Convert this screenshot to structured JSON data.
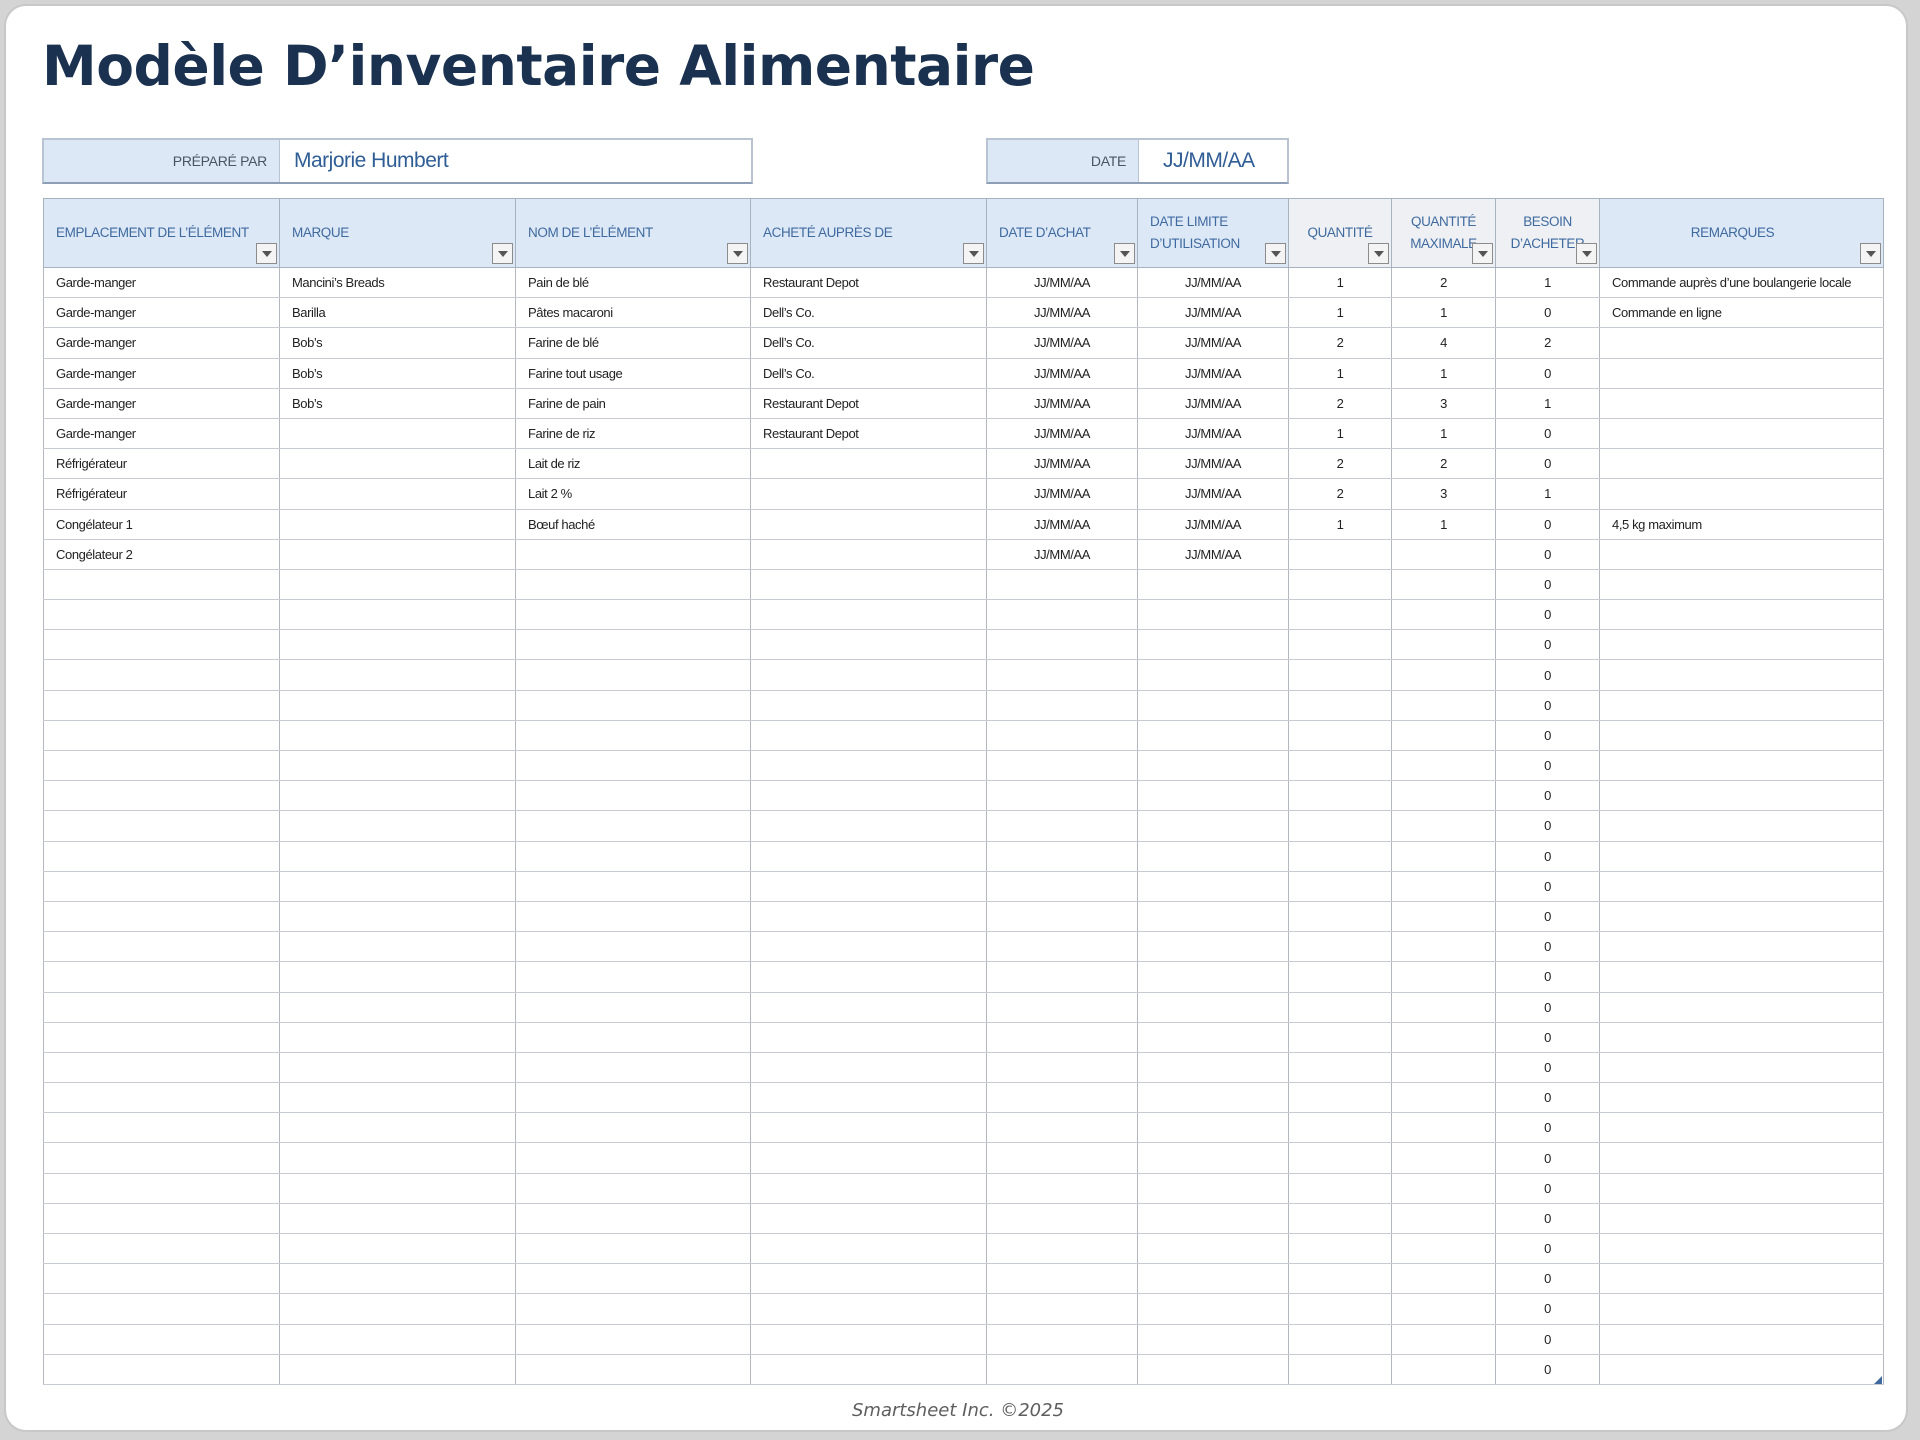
{
  "title": "Modèle D’inventaire Alimentaire",
  "prepared_by": {
    "label": "PRÉPARÉ PAR",
    "value": "Marjorie Humbert"
  },
  "date": {
    "label": "DATE",
    "value": "JJ/MM/AA"
  },
  "columns": [
    "EMPLACEMENT DE L’ÉLÉMENT",
    "MARQUE",
    "NOM DE L’ÉLÉMENT",
    "ACHETÉ AUPRÈS DE",
    "DATE D’ACHAT",
    "DATE LIMITE D’UTILISATION",
    "QUANTITÉ",
    "QUANTITÉ MAXIMALE",
    "BESOIN D’ACHETER",
    "REMARQUES"
  ],
  "rows": [
    [
      "Garde-manger",
      "Mancini’s Breads",
      "Pain de blé",
      "Restaurant Depot",
      "JJ/MM/AA",
      "JJ/MM/AA",
      "1",
      "2",
      "1",
      "Commande auprès d’une boulangerie locale"
    ],
    [
      "Garde-manger",
      "Barilla",
      "Pâtes macaroni",
      "Dell’s Co.",
      "JJ/MM/AA",
      "JJ/MM/AA",
      "1",
      "1",
      "0",
      "Commande en ligne"
    ],
    [
      "Garde-manger",
      "Bob’s",
      "Farine de blé",
      "Dell’s Co.",
      "JJ/MM/AA",
      "JJ/MM/AA",
      "2",
      "4",
      "2",
      ""
    ],
    [
      "Garde-manger",
      "Bob’s",
      "Farine tout usage",
      "Dell’s Co.",
      "JJ/MM/AA",
      "JJ/MM/AA",
      "1",
      "1",
      "0",
      ""
    ],
    [
      "Garde-manger",
      "Bob’s",
      "Farine de pain",
      "Restaurant Depot",
      "JJ/MM/AA",
      "JJ/MM/AA",
      "2",
      "3",
      "1",
      ""
    ],
    [
      "Garde-manger",
      "",
      "Farine de riz",
      "Restaurant Depot",
      "JJ/MM/AA",
      "JJ/MM/AA",
      "1",
      "1",
      "0",
      ""
    ],
    [
      "Réfrigérateur",
      "",
      "Lait de riz",
      "",
      "JJ/MM/AA",
      "JJ/MM/AA",
      "2",
      "2",
      "0",
      ""
    ],
    [
      "Réfrigérateur",
      "",
      "Lait 2 %",
      "",
      "JJ/MM/AA",
      "JJ/MM/AA",
      "2",
      "3",
      "1",
      ""
    ],
    [
      "Congélateur 1",
      "",
      "Bœuf haché",
      "",
      "JJ/MM/AA",
      "JJ/MM/AA",
      "1",
      "1",
      "0",
      "4,5 kg maximum"
    ],
    [
      "Congélateur 2",
      "",
      "",
      "",
      "JJ/MM/AA",
      "JJ/MM/AA",
      "",
      "",
      "0",
      ""
    ],
    [
      "",
      "",
      "",
      "",
      "",
      "",
      "",
      "",
      "0",
      ""
    ],
    [
      "",
      "",
      "",
      "",
      "",
      "",
      "",
      "",
      "0",
      ""
    ],
    [
      "",
      "",
      "",
      "",
      "",
      "",
      "",
      "",
      "0",
      ""
    ],
    [
      "",
      "",
      "",
      "",
      "",
      "",
      "",
      "",
      "0",
      ""
    ],
    [
      "",
      "",
      "",
      "",
      "",
      "",
      "",
      "",
      "0",
      ""
    ],
    [
      "",
      "",
      "",
      "",
      "",
      "",
      "",
      "",
      "0",
      ""
    ],
    [
      "",
      "",
      "",
      "",
      "",
      "",
      "",
      "",
      "0",
      ""
    ],
    [
      "",
      "",
      "",
      "",
      "",
      "",
      "",
      "",
      "0",
      ""
    ],
    [
      "",
      "",
      "",
      "",
      "",
      "",
      "",
      "",
      "0",
      ""
    ],
    [
      "",
      "",
      "",
      "",
      "",
      "",
      "",
      "",
      "0",
      ""
    ],
    [
      "",
      "",
      "",
      "",
      "",
      "",
      "",
      "",
      "0",
      ""
    ],
    [
      "",
      "",
      "",
      "",
      "",
      "",
      "",
      "",
      "0",
      ""
    ],
    [
      "",
      "",
      "",
      "",
      "",
      "",
      "",
      "",
      "0",
      ""
    ],
    [
      "",
      "",
      "",
      "",
      "",
      "",
      "",
      "",
      "0",
      ""
    ],
    [
      "",
      "",
      "",
      "",
      "",
      "",
      "",
      "",
      "0",
      ""
    ],
    [
      "",
      "",
      "",
      "",
      "",
      "",
      "",
      "",
      "0",
      ""
    ],
    [
      "",
      "",
      "",
      "",
      "",
      "",
      "",
      "",
      "0",
      ""
    ],
    [
      "",
      "",
      "",
      "",
      "",
      "",
      "",
      "",
      "0",
      ""
    ],
    [
      "",
      "",
      "",
      "",
      "",
      "",
      "",
      "",
      "0",
      ""
    ],
    [
      "",
      "",
      "",
      "",
      "",
      "",
      "",
      "",
      "0",
      ""
    ],
    [
      "",
      "",
      "",
      "",
      "",
      "",
      "",
      "",
      "0",
      ""
    ],
    [
      "",
      "",
      "",
      "",
      "",
      "",
      "",
      "",
      "0",
      ""
    ],
    [
      "",
      "",
      "",
      "",
      "",
      "",
      "",
      "",
      "0",
      ""
    ],
    [
      "",
      "",
      "",
      "",
      "",
      "",
      "",
      "",
      "0",
      ""
    ],
    [
      "",
      "",
      "",
      "",
      "",
      "",
      "",
      "",
      "0",
      ""
    ],
    [
      "",
      "",
      "",
      "",
      "",
      "",
      "",
      "",
      "0",
      ""
    ],
    [
      "",
      "",
      "",
      "",
      "",
      "",
      "",
      "",
      "0",
      ""
    ]
  ],
  "footer": "Smartsheet Inc. ©2025",
  "colors": {
    "title": "#1b3150",
    "header_bg": "#dde8f6",
    "header_text": "#3e6aa0",
    "number_blue": "#2f6db5"
  }
}
